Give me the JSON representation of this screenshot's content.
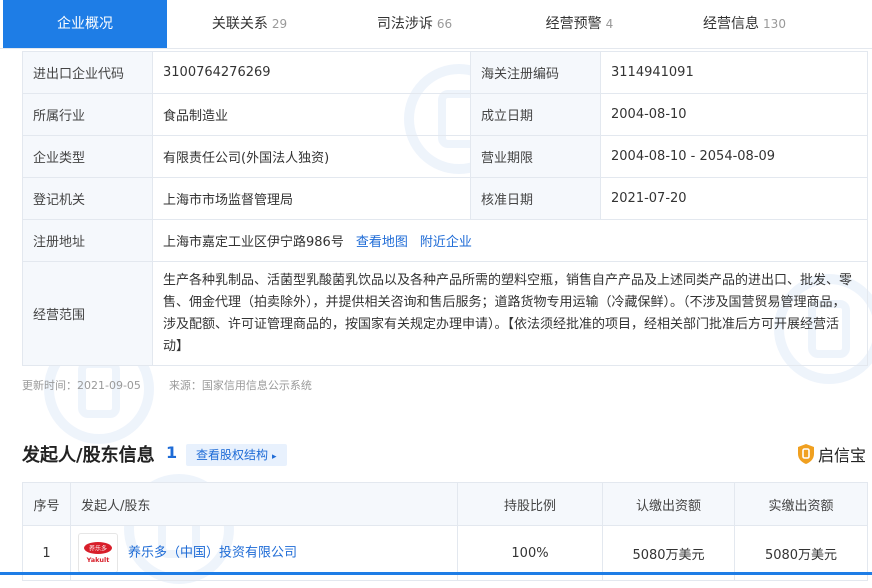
{
  "tabs": [
    {
      "label": "企业概况",
      "count": ""
    },
    {
      "label": "关联关系",
      "count": "29"
    },
    {
      "label": "司法涉诉",
      "count": "66"
    },
    {
      "label": "经营预警",
      "count": "4"
    },
    {
      "label": "经营信息",
      "count": "130"
    }
  ],
  "info": {
    "import_export_code_label": "进出口企业代码",
    "import_export_code": "3100764276269",
    "customs_code_label": "海关注册编码",
    "customs_code": "3114941091",
    "industry_label": "所属行业",
    "industry": "食品制造业",
    "established_label": "成立日期",
    "established": "2004-08-10",
    "company_type_label": "企业类型",
    "company_type": "有限责任公司(外国法人独资)",
    "term_label": "营业期限",
    "term": "2004-08-10 - 2054-08-09",
    "authority_label": "登记机关",
    "authority": "上海市市场监督管理局",
    "approval_label": "核准日期",
    "approval_date": "2021-07-20",
    "address_label": "注册地址",
    "address": "上海市嘉定工业区伊宁路986号",
    "view_map_link": "查看地图",
    "nearby_link": "附近企业",
    "scope_label": "经营范围",
    "scope": "生产各种乳制品、活菌型乳酸菌乳饮品以及各种产品所需的塑料空瓶，销售自产产品及上述同类产品的进出口、批发、零售、佣金代理（拍卖除外），并提供相关咨询和售后服务；道路货物专用运输（冷藏保鲜）。（不涉及国营贸易管理商品，涉及配额、许可证管理商品的，按国家有关规定办理申请）。【依法须经批准的项目，经相关部门批准后方可开展经营活动】"
  },
  "meta": {
    "updated": "更新时间：2021-09-05",
    "source": "来源：国家信用信息公示系统"
  },
  "shareholders": {
    "title": "发起人/股东信息",
    "count": "1",
    "equity_button": "查看股权结构",
    "brand": "启信宝",
    "columns": [
      "序号",
      "发起人/股东",
      "持股比例",
      "认缴出资额",
      "实缴出资额"
    ],
    "rows": [
      {
        "index": "1",
        "logo_text": "养乐多",
        "logo_sub": "Yakult",
        "name": "养乐多（中国）投资有限公司",
        "ratio": "100%",
        "subscribed": "5080万美元",
        "paid": "5080万美元"
      }
    ]
  },
  "colors": {
    "accent": "#1e7de6",
    "link": "#1e6bd6",
    "brand_orange": "#f0a020",
    "logo_red": "#d81e2a"
  },
  "watermark_text": "启信宝"
}
